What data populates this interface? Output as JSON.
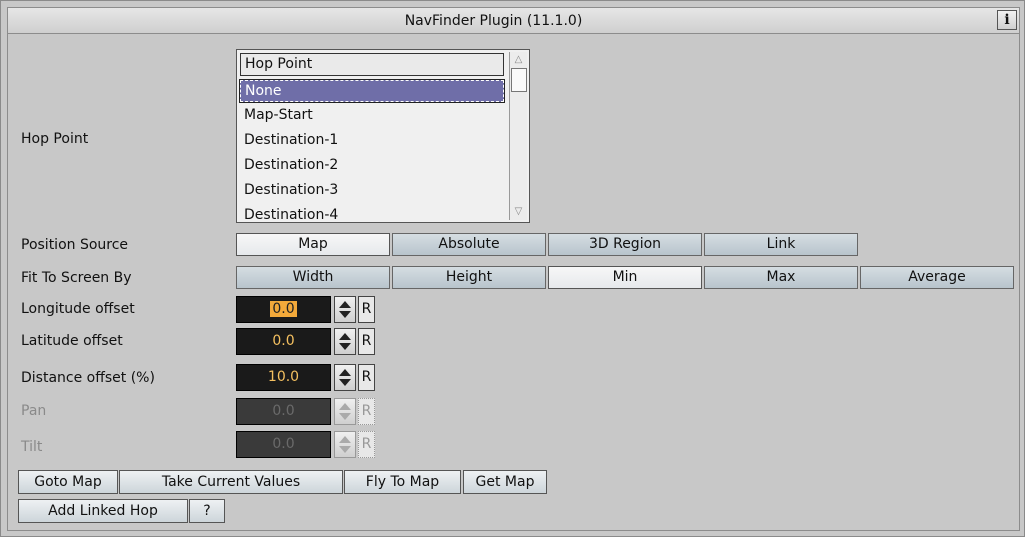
{
  "title": "NavFinder Plugin (11.1.0)",
  "info_label": "i",
  "hop_point": {
    "label": "Hop Point",
    "header": "Hop Point",
    "items": [
      "None",
      "Map-Start",
      "Destination-1",
      "Destination-2",
      "Destination-3",
      "Destination-4"
    ],
    "selected": "None"
  },
  "position_source": {
    "label": "Position Source",
    "options": [
      "Map",
      "Absolute",
      "3D Region",
      "Link"
    ],
    "selected": "Map"
  },
  "fit_to_screen": {
    "label": "Fit To Screen By",
    "options": [
      "Width",
      "Height",
      "Min",
      "Max",
      "Average"
    ],
    "selected": "Min"
  },
  "fields": [
    {
      "label": "Longitude offset",
      "value": "0.0",
      "reset": "R",
      "enabled": true
    },
    {
      "label": "Latitude offset",
      "value": "0.0",
      "reset": "R",
      "enabled": true
    },
    {
      "label": "Distance offset (%)",
      "value": "10.0",
      "reset": "R",
      "enabled": true
    },
    {
      "label": "Pan",
      "value": "0.0",
      "reset": "R",
      "enabled": false
    },
    {
      "label": "Tilt",
      "value": "0.0",
      "reset": "R",
      "enabled": false
    }
  ],
  "actions": {
    "goto_map": "Goto Map",
    "take_current_values": "Take Current Values",
    "fly_to_map": "Fly To Map",
    "get_map": "Get Map",
    "add_linked_hop": "Add Linked Hop",
    "help": "?"
  },
  "icons": {
    "scroll_up": "scroll-up-icon",
    "scroll_down": "scroll-down-icon",
    "spin": "spin-updown-icon"
  }
}
